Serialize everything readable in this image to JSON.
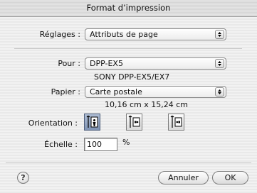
{
  "window": {
    "title": "Format d’impression"
  },
  "settings": {
    "label": "Réglages :",
    "value": "Attributs de page"
  },
  "printer": {
    "label": "Pour :",
    "value": "DPP-EX5",
    "description": "SONY DPP-EX5/EX7"
  },
  "paper": {
    "label": "Papier :",
    "value": "Carte postale",
    "dimensions": "10,16 cm x 15,24 cm"
  },
  "orientation": {
    "label": "Orientation :",
    "options": [
      "portrait",
      "landscape",
      "landscape-reversed"
    ],
    "selected": "portrait"
  },
  "scale": {
    "label": "Échelle :",
    "value": "100",
    "unit": "%"
  },
  "buttons": {
    "help": "?",
    "cancel": "Annuler",
    "ok": "OK"
  }
}
